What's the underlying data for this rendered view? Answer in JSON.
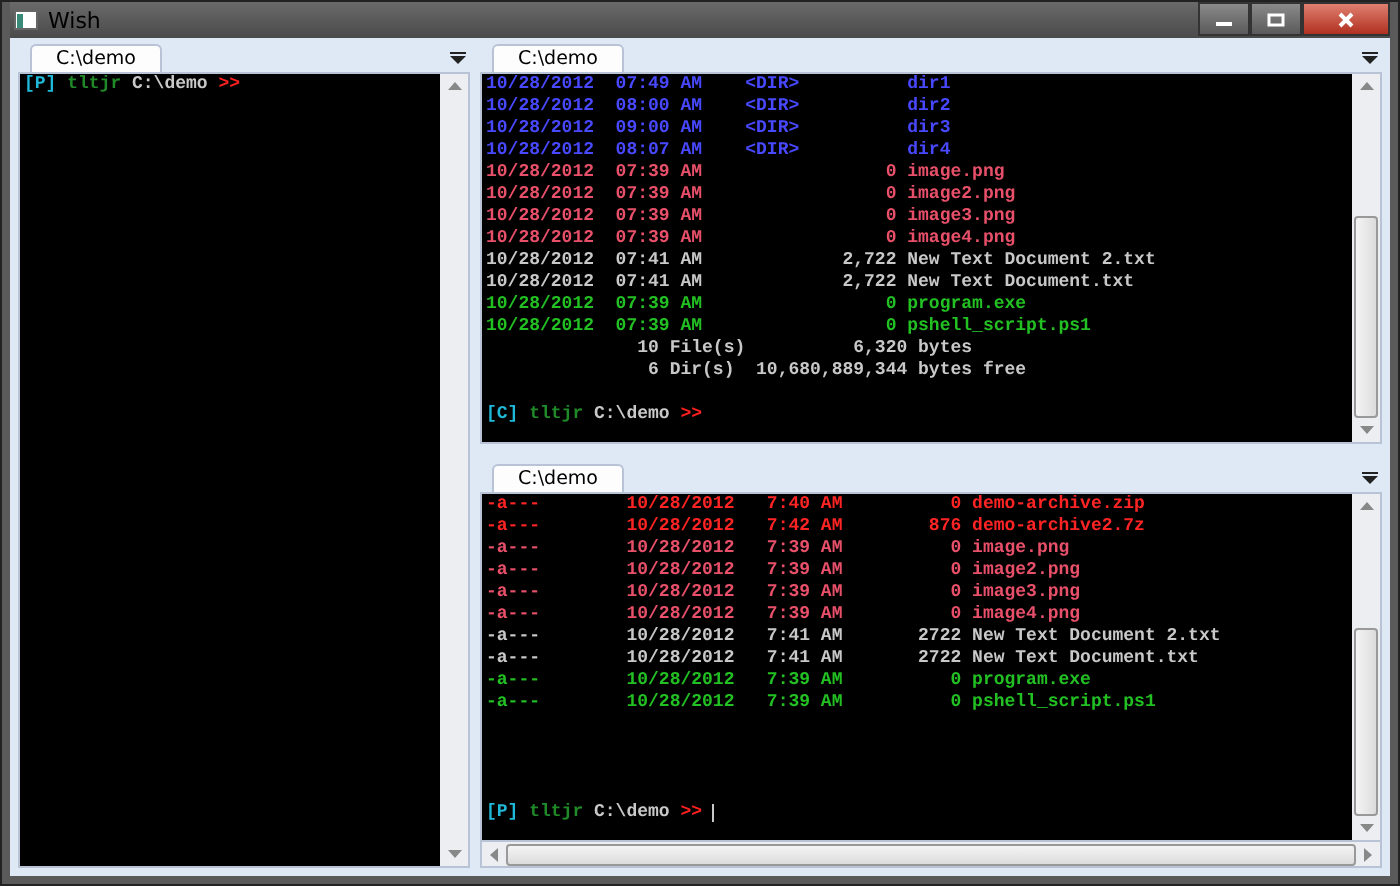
{
  "window": {
    "title": "Wish"
  },
  "panes": [
    {
      "tab": {
        "label": "C:\\demo",
        "selected": true
      },
      "cursor": false,
      "lines": [
        {
          "kind": "prompt",
          "tag": "[P]",
          "user": "tltjr",
          "path": "C:\\demo",
          "arrow": ">>"
        }
      ]
    },
    {
      "tab": {
        "label": "C:\\demo",
        "selected": true
      },
      "cursor": false,
      "lines": [
        {
          "kind": "dir",
          "text": "10/28/2012  07:49 AM    <DIR>          dir1"
        },
        {
          "kind": "dir",
          "text": "10/28/2012  08:00 AM    <DIR>          dir2"
        },
        {
          "kind": "dir",
          "text": "10/28/2012  09:00 AM    <DIR>          dir3"
        },
        {
          "kind": "dir",
          "text": "10/28/2012  08:07 AM    <DIR>          dir4"
        },
        {
          "kind": "image",
          "text": "10/28/2012  07:39 AM                 0 image.png"
        },
        {
          "kind": "image",
          "text": "10/28/2012  07:39 AM                 0 image2.png"
        },
        {
          "kind": "image",
          "text": "10/28/2012  07:39 AM                 0 image3.png"
        },
        {
          "kind": "image",
          "text": "10/28/2012  07:39 AM                 0 image4.png"
        },
        {
          "kind": "text",
          "text": "10/28/2012  07:41 AM             2,722 New Text Document 2.txt"
        },
        {
          "kind": "text",
          "text": "10/28/2012  07:41 AM             2,722 New Text Document.txt"
        },
        {
          "kind": "exec",
          "text": "10/28/2012  07:39 AM                 0 program.exe"
        },
        {
          "kind": "exec",
          "text": "10/28/2012  07:39 AM                 0 pshell_script.ps1"
        },
        {
          "kind": "summary",
          "text": "              10 File(s)          6,320 bytes"
        },
        {
          "kind": "summary",
          "text": "               6 Dir(s)  10,680,889,344 bytes free"
        },
        {
          "kind": "blank"
        },
        {
          "kind": "prompt",
          "tag": "[C]",
          "user": "tltjr",
          "path": "C:\\demo",
          "arrow": ">>"
        }
      ]
    },
    {
      "tab": {
        "label": "C:\\demo",
        "selected": true
      },
      "cursor": true,
      "lines": [
        {
          "kind": "archive",
          "text": "-a---        10/28/2012   7:40 AM          0 demo-archive.zip"
        },
        {
          "kind": "archive",
          "text": "-a---        10/28/2012   7:42 AM        876 demo-archive2.7z"
        },
        {
          "kind": "image",
          "text": "-a---        10/28/2012   7:39 AM          0 image.png"
        },
        {
          "kind": "image",
          "text": "-a---        10/28/2012   7:39 AM          0 image2.png"
        },
        {
          "kind": "image",
          "text": "-a---        10/28/2012   7:39 AM          0 image3.png"
        },
        {
          "kind": "image",
          "text": "-a---        10/28/2012   7:39 AM          0 image4.png"
        },
        {
          "kind": "text",
          "text": "-a---        10/28/2012   7:41 AM       2722 New Text Document 2.txt"
        },
        {
          "kind": "text",
          "text": "-a---        10/28/2012   7:41 AM       2722 New Text Document.txt"
        },
        {
          "kind": "exec",
          "text": "-a---        10/28/2012   7:39 AM          0 program.exe"
        },
        {
          "kind": "exec",
          "text": "-a---        10/28/2012   7:39 AM          0 pshell_script.ps1"
        },
        {
          "kind": "blank"
        },
        {
          "kind": "blank"
        },
        {
          "kind": "blank"
        },
        {
          "kind": "blank"
        },
        {
          "kind": "prompt",
          "tag": "[P]",
          "user": "tltjr",
          "path": "C:\\demo",
          "arrow": ">>"
        }
      ]
    }
  ]
}
